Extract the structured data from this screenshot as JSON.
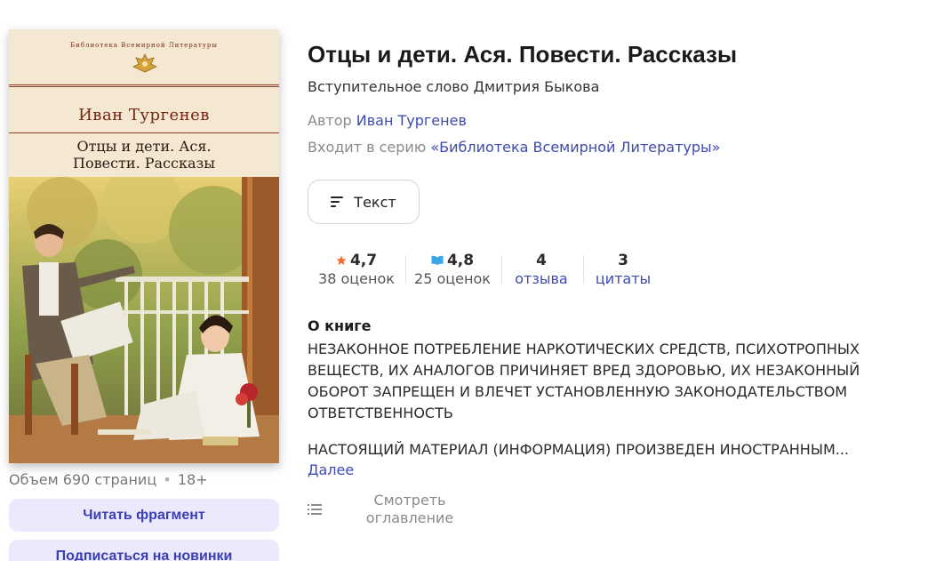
{
  "cover": {
    "series": "Библиотека Всемирной Литературы",
    "author": "Иван Тургенев",
    "title_line1": "Отцы и дети. Ася.",
    "title_line2": "Повести. Рассказы"
  },
  "meta": {
    "pages": "Объем 690 страниц",
    "separator": "•",
    "age": "18+"
  },
  "actions": {
    "read_fragment": "Читать фрагмент",
    "subscribe": "Подписаться на новинки"
  },
  "book": {
    "title": "Отцы и дети. Ася. Повести. Рассказы",
    "subtitle": "Вступительное слово Дмитрия Быкова",
    "author_label": "Автор",
    "author_name": "Иван Тургенев",
    "series_label": "Входит в серию",
    "series_name": "«Библиотека Всемирной Литературы»"
  },
  "format_button": {
    "label": "Текст",
    "icon": "text-lines-icon"
  },
  "stats": [
    {
      "value": "4,7",
      "label": "38 оценок",
      "icon": "star-icon",
      "icon_color": "#f26b2c"
    },
    {
      "value": "4,8",
      "label": "25 оценок",
      "icon": "book-open-icon",
      "icon_color": "#3aa6e8"
    },
    {
      "value": "4",
      "label": "отзыва"
    },
    {
      "value": "3",
      "label": "цитаты"
    }
  ],
  "about": {
    "heading": "О книге",
    "paragraph1": "НЕЗАКОННОЕ ПОТРЕБЛЕНИЕ НАРКОТИЧЕСКИХ СРЕДСТВ, ПСИХОТРОПНЫХ ВЕЩЕСТВ, ИХ АНАЛОГОВ ПРИЧИНЯЕТ ВРЕД ЗДОРОВЬЮ, ИХ НЕЗАКОННЫЙ ОБОРОТ ЗАПРЕЩЕН И ВЛЕЧЕТ УСТАНОВЛЕННУЮ ЗАКОНОДАТЕЛЬСТВОМ ОТВЕТСТВЕННОСТЬ",
    "paragraph2": "НАСТОЯЩИЙ МАТЕРИАЛ (ИНФОРМАЦИЯ) ПРОИЗВЕДЕН ИНОСТРАННЫМ...",
    "more": "Далее"
  },
  "toc": {
    "line1": "Смотреть",
    "line2": "оглавление"
  },
  "colors": {
    "link": "#3f4ab0",
    "soft_button_bg": "#ebe9fb",
    "soft_button_text": "#3b3fb5"
  }
}
